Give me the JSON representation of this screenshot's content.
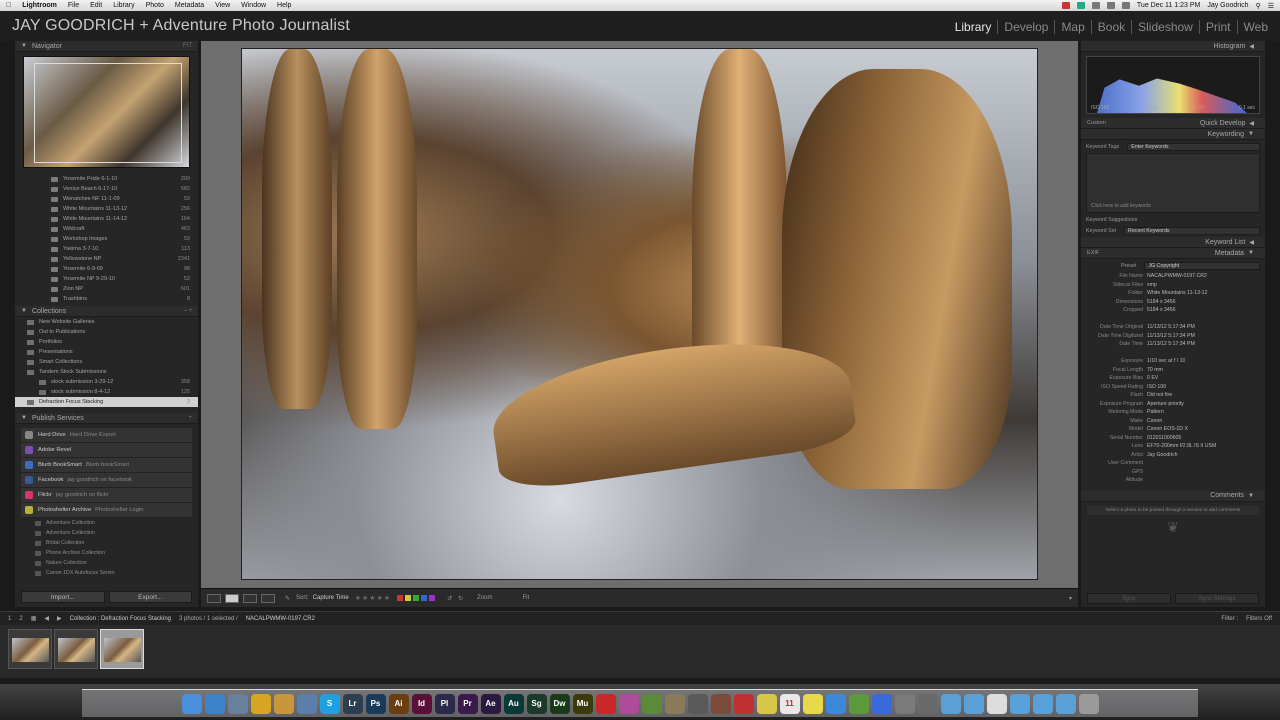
{
  "menubar": {
    "app": "Lightroom",
    "items": [
      "File",
      "Edit",
      "Library",
      "Photo",
      "Metadata",
      "View",
      "Window",
      "Help"
    ],
    "clock": "Tue Dec 11  1:23 PM",
    "user": "Jay Goodrich"
  },
  "identity_plate": "JAY GOODRICH + Adventure Photo Journalist",
  "modules": [
    "Library",
    "Develop",
    "Map",
    "Book",
    "Slideshow",
    "Print",
    "Web"
  ],
  "left": {
    "navigator": {
      "title": "Navigator",
      "zoom": "FIT"
    },
    "folders": [
      {
        "name": "Yosemite Pride 6-1-10",
        "count": "209"
      },
      {
        "name": "Venice Beach 6-17-10",
        "count": "582"
      },
      {
        "name": "Wenatchee NF 11-1-09",
        "count": "59"
      },
      {
        "name": "White Mountains 11-13-12",
        "count": "256"
      },
      {
        "name": "White Mountains 11-14-12",
        "count": "164"
      },
      {
        "name": "Wildcraft",
        "count": "463"
      },
      {
        "name": "Workshop Images",
        "count": "59"
      },
      {
        "name": "Yakima 3-7-10",
        "count": "113"
      },
      {
        "name": "Yellowstone NP",
        "count": "2341"
      },
      {
        "name": "Yosemite 6-9-09",
        "count": "98"
      },
      {
        "name": "Yosemite NP 9-29-10",
        "count": "52"
      },
      {
        "name": "Zion NP",
        "count": "601"
      },
      {
        "name": "Trashbins",
        "count": "8"
      }
    ],
    "collections_title": "Collections",
    "collections": [
      {
        "name": "New Website Galleries",
        "count": "",
        "selected": false
      },
      {
        "name": "Out to Publications",
        "count": "",
        "selected": false
      },
      {
        "name": "Portfolios",
        "count": "",
        "selected": false
      },
      {
        "name": "Presentations",
        "count": "",
        "selected": false
      },
      {
        "name": "Smart Collections",
        "count": "",
        "selected": false
      },
      {
        "name": "Tandem Stock Submissions",
        "count": "",
        "selected": false
      },
      {
        "name": "stock submission 3-29-12",
        "count": "358",
        "selected": false
      },
      {
        "name": "stock submission 8-4-12",
        "count": "125",
        "selected": false
      },
      {
        "name": "Defraction Focus Stacking",
        "count": "3",
        "selected": true
      }
    ],
    "publish_title": "Publish Services",
    "publish": [
      {
        "name": "Hard Drive",
        "sub": "Hard Drive Export",
        "color": "#888888"
      },
      {
        "name": "Adobe Revel",
        "sub": "",
        "color": "#7a4fb0"
      },
      {
        "name": "Blurb BookSmart",
        "sub": "Blurb bookSmart",
        "color": "#3d6cc4"
      },
      {
        "name": "Facebook",
        "sub": "jay goodrich on facebook",
        "color": "#3b5998"
      },
      {
        "name": "Flickr",
        "sub": "jay goodrich on flickr",
        "color": "#d6356e"
      },
      {
        "name": "Photoshelter Archive",
        "sub": "Photoshelter Login",
        "color": "#b5b03c"
      }
    ],
    "publish_subs": [
      "Adventure Collection",
      "Adventure Collection",
      "Bridal Collection",
      "Phone Archive Collection",
      "Nature Collection",
      "Canon 1DX Autofocus Series"
    ],
    "import_label": "Import...",
    "export_label": "Export..."
  },
  "toolbar": {
    "sort_label": "Sort:",
    "sort_value": "Capture Time",
    "zoom_label": "Zoom",
    "zoom_value": "Fit"
  },
  "right": {
    "histogram_title": "Histogram",
    "histo_labels": [
      "ISO 100",
      "70mm",
      "f / 10",
      "0.1 sec"
    ],
    "quick_develop": "Quick Develop",
    "preset_value": "Custom",
    "keywording": "Keywording",
    "keyword_tags_label": "Keyword Tags",
    "keyword_tags_value": "Enter Keywords",
    "keyword_placeholder": "Click here to add keywords",
    "keyword_suggestions": "Keyword Suggestions",
    "keyword_set_label": "Keyword Set",
    "keyword_set_value": "Recent Keywords",
    "keyword_list": "Keyword List",
    "metadata": "Metadata",
    "metadata_mode": "EXIF",
    "preset_label": "Preset",
    "preset_meta": "JG Copyright",
    "meta_rows": [
      {
        "k": "File Name",
        "v": "NACALPWMW-0197.CR2"
      },
      {
        "k": "Sidecar Files",
        "v": "xmp"
      },
      {
        "k": "Folder",
        "v": "White Mountains 11-13-12"
      },
      {
        "k": "Dimensions",
        "v": "5184 x 3456"
      },
      {
        "k": "Cropped",
        "v": "5184 x 3456"
      },
      {
        "k": "",
        "v": ""
      },
      {
        "k": "Date Time Original",
        "v": "11/13/12 5:17:34 PM"
      },
      {
        "k": "Date Time Digitized",
        "v": "11/13/12 5:17:34 PM"
      },
      {
        "k": "Date Time",
        "v": "11/13/12 5:17:34 PM"
      },
      {
        "k": "",
        "v": ""
      },
      {
        "k": "Exposure",
        "v": "1/10 sec at f / 10"
      },
      {
        "k": "Focal Length",
        "v": "70 mm"
      },
      {
        "k": "Exposure Bias",
        "v": "0 EV"
      },
      {
        "k": "ISO Speed Rating",
        "v": "ISO 100"
      },
      {
        "k": "Flash",
        "v": "Did not fire"
      },
      {
        "k": "Exposure Program",
        "v": "Aperture priority"
      },
      {
        "k": "Metering Mode",
        "v": "Pattern"
      },
      {
        "k": "Make",
        "v": "Canon"
      },
      {
        "k": "Model",
        "v": "Canon EOS-1D X"
      },
      {
        "k": "Serial Number",
        "v": "012011000605"
      },
      {
        "k": "Lens",
        "v": "EF70-200mm f/2.8L IS II USM"
      },
      {
        "k": "Artist",
        "v": "Jay Goodrich"
      },
      {
        "k": "User Comment",
        "v": ""
      },
      {
        "k": "GPS",
        "v": ""
      },
      {
        "k": "Altitude",
        "v": ""
      }
    ],
    "comments": "Comments",
    "comments_note": "Select a photo to be posted through a service to add comments",
    "sync_label": "Sync",
    "sync_settings_label": "Sync Settings"
  },
  "filmstrip": {
    "page1": "1",
    "page2": "2",
    "source": "Collection : Defraction Focus Stacking",
    "info": "3 photos / 1 selected /",
    "selected_file": "NACALPWMW-0197.CR2",
    "filter_label": "Filter :",
    "filter_value": "Filters Off"
  },
  "dock": {
    "icons": [
      {
        "name": "finder",
        "txt": "",
        "color": "#4a8fd9"
      },
      {
        "name": "safari",
        "txt": "",
        "color": "#3d83c9"
      },
      {
        "name": "mail",
        "txt": "",
        "color": "#6a7f9a"
      },
      {
        "name": "chrome",
        "txt": "",
        "color": "#d6a524"
      },
      {
        "name": "box",
        "txt": "",
        "color": "#c9973a"
      },
      {
        "name": "preview",
        "txt": "",
        "color": "#5a7fa8"
      },
      {
        "name": "skype",
        "txt": "S",
        "color": "#1fa0e0"
      },
      {
        "name": "lightroom",
        "txt": "Lr",
        "color": "#2d3e50"
      },
      {
        "name": "photoshop",
        "txt": "Ps",
        "color": "#1a3a5a"
      },
      {
        "name": "illustrator",
        "txt": "Ai",
        "color": "#6a3e0e"
      },
      {
        "name": "indesign",
        "txt": "Id",
        "color": "#5a1036"
      },
      {
        "name": "photoshop-lightroom",
        "txt": "Pl",
        "color": "#2a2a4a"
      },
      {
        "name": "premiere",
        "txt": "Pr",
        "color": "#3a1a4a"
      },
      {
        "name": "after-effects",
        "txt": "Ae",
        "color": "#2a1a40"
      },
      {
        "name": "audition",
        "txt": "Au",
        "color": "#0a3a36"
      },
      {
        "name": "speedgrade",
        "txt": "Sg",
        "color": "#1a3a2a"
      },
      {
        "name": "dreamweaver",
        "txt": "Dw",
        "color": "#1a3a1a"
      },
      {
        "name": "muse",
        "txt": "Mu",
        "color": "#3a3a0a"
      },
      {
        "name": "acrobat",
        "txt": "",
        "color": "#c8282a"
      },
      {
        "name": "itunes",
        "txt": "",
        "color": "#b04a9a"
      },
      {
        "name": "editor",
        "txt": "",
        "color": "#5a8a3a"
      },
      {
        "name": "pencil",
        "txt": "",
        "color": "#8a7a5a"
      },
      {
        "name": "camera",
        "txt": "",
        "color": "#5a5a5a"
      },
      {
        "name": "tools",
        "txt": "",
        "color": "#7a4a3a"
      },
      {
        "name": "red-app",
        "txt": "",
        "color": "#c03030"
      },
      {
        "name": "notes",
        "txt": "",
        "color": "#d8c84a"
      },
      {
        "name": "calendar",
        "txt": "11",
        "color": "#e8e8e8"
      },
      {
        "name": "stickies",
        "txt": "",
        "color": "#e8d84a"
      },
      {
        "name": "app-store",
        "txt": "",
        "color": "#3a8ad9"
      },
      {
        "name": "maps",
        "txt": "",
        "color": "#5a9a3a"
      },
      {
        "name": "dropbox",
        "txt": "",
        "color": "#3a6ad9"
      },
      {
        "name": "settings",
        "txt": "",
        "color": "#7a7a7a"
      },
      {
        "name": "utilities",
        "txt": "",
        "color": "#6a6a6a"
      },
      {
        "name": "folder-1",
        "txt": "",
        "color": "#5aa0d8"
      },
      {
        "name": "folder-2",
        "txt": "",
        "color": "#5aa0d8"
      },
      {
        "name": "document",
        "txt": "",
        "color": "#dddddd"
      },
      {
        "name": "folder-3",
        "txt": "",
        "color": "#5aa0d8"
      },
      {
        "name": "folder-4",
        "txt": "",
        "color": "#5aa0d8"
      },
      {
        "name": "folder-5",
        "txt": "",
        "color": "#5aa0d8"
      },
      {
        "name": "trash",
        "txt": "",
        "color": "#9a9a9a"
      }
    ]
  }
}
